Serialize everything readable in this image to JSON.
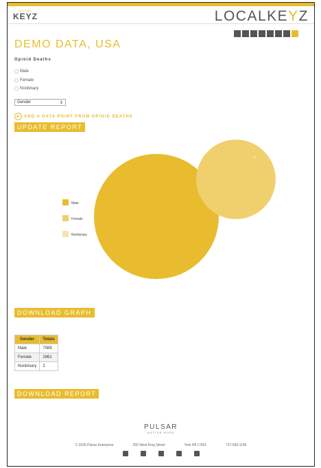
{
  "header": {
    "small_brand_sup": "PULSAR",
    "small_brand_word": "KEYZ",
    "big_brand_prefix": "LOCALKE",
    "big_brand_y": "Y",
    "big_brand_suffix": "Z"
  },
  "toolbar_icons": [
    "bar-chart-icon",
    "column-chart-icon",
    "list-icon",
    "line-chart-icon",
    "pie-chart-icon",
    "bubble-chart-icon",
    "map-icon",
    "close-icon"
  ],
  "page": {
    "title": "DEMO DATA, USA",
    "subtitle": "Opioid Deaths"
  },
  "filters": [
    "Male",
    "Female",
    "Nonbinary"
  ],
  "select": {
    "value": "Gender"
  },
  "add_point_label": "ADD A DATA POINT FROM OPIOID DEATHS",
  "buttons": {
    "update": "UPDATE REPORT",
    "download_graph": "DOWNLOAD GRAPH",
    "download_report": "DOWNLOAD REPORT"
  },
  "chart_data": {
    "type": "scatter",
    "categories": [
      "Male",
      "Female",
      "Nonbinary"
    ],
    "values": [
      7089,
      2861,
      2
    ],
    "colors": [
      "#e8bc2e",
      "#f0d06d",
      "#f6e4a8"
    ],
    "legend_position": "left"
  },
  "table": {
    "headers": [
      "Gender",
      "Totals"
    ],
    "rows": [
      [
        "Male",
        "7089"
      ],
      [
        "Female",
        "2861"
      ],
      [
        "Nonbinary",
        "2"
      ]
    ]
  },
  "footer": {
    "logo": "PULSAR",
    "tagline": "MATTER MORE",
    "copyright": "© 2026 Pulsar Enterprise",
    "address": "255 West King Street",
    "city": "York PA 17401",
    "phone": "717.650.1196",
    "social": [
      "facebook-icon",
      "instagram-icon",
      "linkedin-icon",
      "x-icon",
      "youtube-icon"
    ]
  }
}
